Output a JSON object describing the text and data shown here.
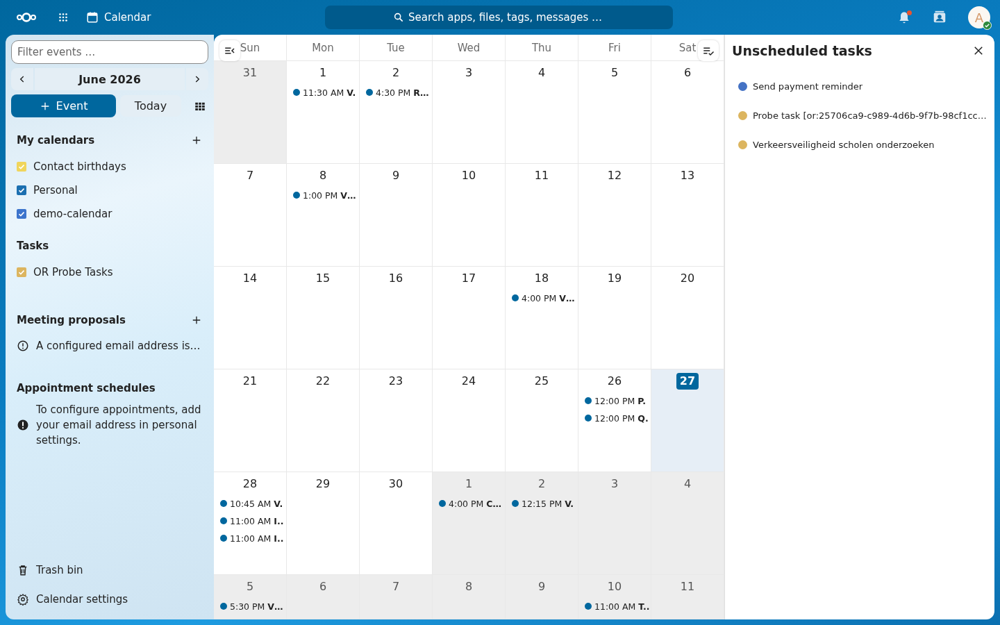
{
  "header": {
    "app": "Calendar",
    "search": {
      "placeholder": "Search apps, files, tags, messages …"
    },
    "notifications": {
      "unread": true
    },
    "avatar": {
      "initial": "A",
      "online": true
    }
  },
  "sidebar": {
    "filter": {
      "placeholder": "Filter events …"
    },
    "month": "June 2026",
    "new_event": "Event",
    "today": "Today",
    "my_calendars": {
      "title": "My calendars",
      "items": [
        {
          "name": "Contact birthdays",
          "checked": true,
          "color": "#f0d55c"
        },
        {
          "name": "Personal",
          "checked": true,
          "color": "#1b6fb0"
        },
        {
          "name": "demo-calendar",
          "checked": true,
          "color": "#3c74cc"
        }
      ]
    },
    "tasks": {
      "title": "Tasks",
      "items": [
        {
          "name": "OR Probe Tasks",
          "checked": true,
          "color": "#dcb55f"
        }
      ]
    },
    "meeting_proposals": {
      "title": "Meeting proposals",
      "notice": "A configured email address is…"
    },
    "appointment_schedules": {
      "title": "Appointment schedules",
      "notice": "To configure appointments, add your email address in personal settings."
    },
    "footer": [
      {
        "kind": "trash",
        "label": "Trash bin"
      },
      {
        "kind": "settings",
        "label": "Calendar settings"
      }
    ]
  },
  "calendar": {
    "weekdays": [
      "Sun",
      "Mon",
      "Tue",
      "Wed",
      "Thu",
      "Fri",
      "Sat"
    ],
    "weeks": [
      [
        {
          "day": "31",
          "muted": true,
          "today": false
        },
        {
          "day": "1",
          "muted": false,
          "today": false,
          "events": [
            "11:30 AM **V.**"
          ]
        },
        {
          "day": "2",
          "muted": false,
          "today": false,
          "events": [
            "4:30 PM **R…**"
          ]
        },
        {
          "day": "3",
          "muted": false,
          "today": false
        },
        {
          "day": "4",
          "muted": false,
          "today": false
        },
        {
          "day": "5",
          "muted": false,
          "today": false
        },
        {
          "day": "6",
          "muted": false,
          "today": false
        }
      ],
      [
        {
          "day": "7",
          "muted": false,
          "today": false
        },
        {
          "day": "8",
          "muted": false,
          "today": false,
          "events": [
            "1:00 PM **V…**"
          ]
        },
        {
          "day": "9",
          "muted": false,
          "today": false
        },
        {
          "day": "10",
          "muted": false,
          "today": false
        },
        {
          "day": "11",
          "muted": false,
          "today": false
        },
        {
          "day": "12",
          "muted": false,
          "today": false
        },
        {
          "day": "13",
          "muted": false,
          "today": false
        }
      ],
      [
        {
          "day": "14",
          "muted": false,
          "today": false
        },
        {
          "day": "15",
          "muted": false,
          "today": false
        },
        {
          "day": "16",
          "muted": false,
          "today": false
        },
        {
          "day": "17",
          "muted": false,
          "today": false
        },
        {
          "day": "18",
          "muted": false,
          "today": false,
          "events": [
            "4:00 PM **V…**"
          ]
        },
        {
          "day": "19",
          "muted": false,
          "today": false
        },
        {
          "day": "20",
          "muted": false,
          "today": false
        }
      ],
      [
        {
          "day": "21",
          "muted": false,
          "today": false
        },
        {
          "day": "22",
          "muted": false,
          "today": false
        },
        {
          "day": "23",
          "muted": false,
          "today": false
        },
        {
          "day": "24",
          "muted": false,
          "today": false
        },
        {
          "day": "25",
          "muted": false,
          "today": false
        },
        {
          "day": "26",
          "muted": false,
          "today": false,
          "events": [
            "12:00 PM **P.**",
            "12:00 PM **Q.**"
          ]
        },
        {
          "day": "27",
          "muted": false,
          "today": true
        }
      ],
      [
        {
          "day": "28",
          "muted": false,
          "today": false,
          "events": [
            "10:45 AM **V.**",
            "11:00 AM **I..**",
            "11:00 AM **I..**"
          ]
        },
        {
          "day": "29",
          "muted": false,
          "today": false
        },
        {
          "day": "30",
          "muted": false,
          "today": false
        },
        {
          "day": "1",
          "muted": true,
          "today": false,
          "events": [
            "4:00 PM **C…**"
          ]
        },
        {
          "day": "2",
          "muted": true,
          "today": false,
          "events": [
            "12:15 PM **V.**"
          ]
        },
        {
          "day": "3",
          "muted": true,
          "today": false
        },
        {
          "day": "4",
          "muted": true,
          "today": false
        }
      ],
      [
        {
          "day": "5",
          "muted": true,
          "today": false,
          "events": [
            "5:30 PM **V…**"
          ]
        },
        {
          "day": "6",
          "muted": true,
          "today": false
        },
        {
          "day": "7",
          "muted": true,
          "today": false
        },
        {
          "day": "8",
          "muted": true,
          "today": false
        },
        {
          "day": "9",
          "muted": true,
          "today": false
        },
        {
          "day": "10",
          "muted": true,
          "today": false,
          "events": [
            "11:00 AM **T..**"
          ]
        },
        {
          "day": "11",
          "muted": true,
          "today": false
        }
      ]
    ]
  },
  "unscheduled": {
    "title": "Unscheduled tasks",
    "items": [
      {
        "label": "Send payment reminder",
        "color": "#4472c4"
      },
      {
        "label": "Probe task [or:25706ca9-c989-4d6b-9f7b-98cf1cc…",
        "color": "#dcb55f"
      },
      {
        "label": "Verkeersveiligheid scholen onderzoeken",
        "color": "#dcb55f"
      }
    ]
  }
}
